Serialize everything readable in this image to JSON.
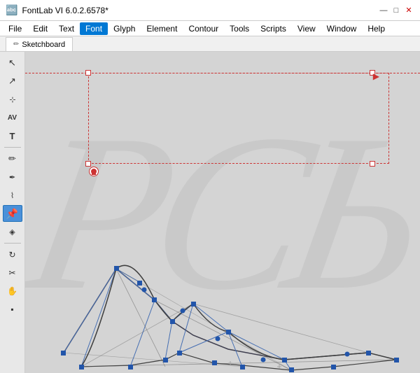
{
  "titleBar": {
    "title": "FontLab VI 6.0.2.6578*",
    "iconSymbol": "🔤",
    "controls": {
      "minimize": "—",
      "maximize": "□",
      "close": "✕"
    }
  },
  "menuBar": {
    "items": [
      "File",
      "Edit",
      "Text",
      "Font",
      "Glyph",
      "Element",
      "Contour",
      "Tools",
      "Scripts",
      "View",
      "Window",
      "Help"
    ]
  },
  "tabBar": {
    "tabs": [
      {
        "label": "Sketchboard",
        "icon": "✏"
      }
    ]
  },
  "toolbar": {
    "tools": [
      {
        "name": "pointer-arrow",
        "symbol": "↖",
        "active": false
      },
      {
        "name": "select-arrow",
        "symbol": "↗",
        "active": false
      },
      {
        "name": "node-tool",
        "symbol": "⊹",
        "active": false
      },
      {
        "name": "text-kerning",
        "symbol": "AV",
        "active": false,
        "small": true
      },
      {
        "name": "text-tool",
        "symbol": "T",
        "active": false
      },
      {
        "name": "separator1",
        "type": "sep"
      },
      {
        "name": "pencil-tool",
        "symbol": "✏",
        "active": false
      },
      {
        "name": "pen-tool",
        "symbol": "✒",
        "active": false
      },
      {
        "name": "rapid-pen",
        "symbol": "⚡",
        "active": false
      },
      {
        "name": "pin-tool",
        "symbol": "📌",
        "active": true
      },
      {
        "name": "eraser-tool",
        "symbol": "✂",
        "active": false
      },
      {
        "name": "separator2",
        "type": "sep"
      },
      {
        "name": "zoom-rotate",
        "symbol": "↻",
        "active": false
      },
      {
        "name": "knife-tool",
        "symbol": "✂",
        "active": false
      },
      {
        "name": "hand-tool",
        "symbol": "✋",
        "active": false
      },
      {
        "name": "fill-tool",
        "symbol": "▪",
        "active": false
      }
    ]
  },
  "canvas": {
    "glyphBg": "РСЬ",
    "accent": "#cc3333",
    "nodeColor": "#2255aa"
  },
  "colors": {
    "bg": "#d4d4d4",
    "toolbar": "#e8e8e8",
    "guideline": "#cc3333",
    "node": "#2255aa"
  }
}
